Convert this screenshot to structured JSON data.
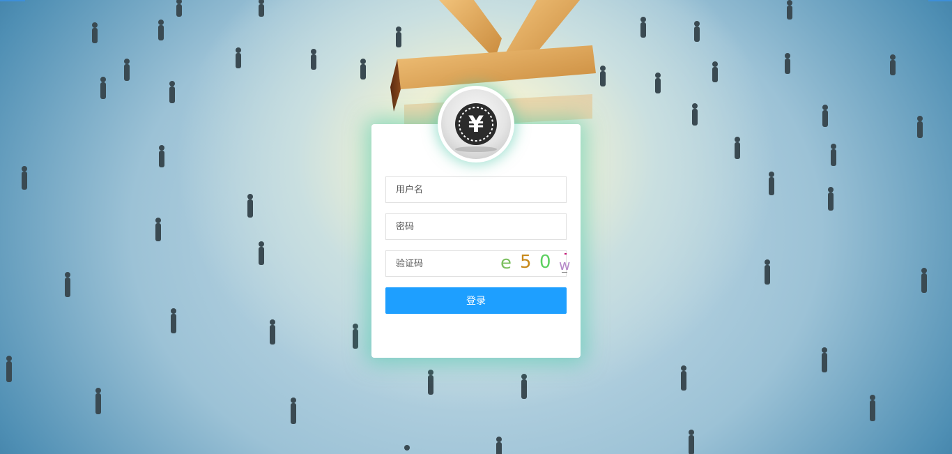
{
  "login": {
    "username_placeholder": "用户名",
    "password_placeholder": "密码",
    "captcha_placeholder": "验证码",
    "captcha_chars": [
      "e",
      "5",
      "0",
      "w"
    ],
    "submit_label": "登录",
    "logo_symbol": "¥"
  },
  "colors": {
    "primary_button": "#1e9fff",
    "card_glow": "#46c8aa"
  }
}
